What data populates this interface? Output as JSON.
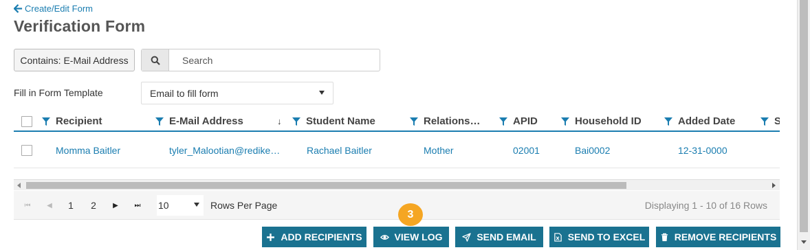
{
  "header": {
    "back_link": "Create/Edit Form",
    "title": "Verification Form"
  },
  "filter": {
    "contains_label": "Contains: E-Mail Address",
    "search_placeholder": "Search"
  },
  "template": {
    "label": "Fill in Form Template",
    "selected": "Email to fill form"
  },
  "table": {
    "columns": [
      {
        "label": "Recipient"
      },
      {
        "label": "E-Mail Address",
        "sort": "↓"
      },
      {
        "label": "Student Name"
      },
      {
        "label": "Relations…"
      },
      {
        "label": "APID"
      },
      {
        "label": "Household ID"
      },
      {
        "label": "Added Date"
      },
      {
        "label": "S"
      }
    ],
    "rows": [
      {
        "recipient": "Momma Baitler",
        "email": "tyler_Malootian@redike…",
        "student": "Rachael Baitler",
        "relationship": "Mother",
        "apid": "02001",
        "household": "Bai0002",
        "added_date": "12-31-0000"
      }
    ]
  },
  "pager": {
    "pages": [
      "1",
      "2"
    ],
    "rows_per_page": "10",
    "rows_label": "Rows Per Page",
    "displaying": "Displaying 1 - 10 of 16 Rows"
  },
  "badge": "3",
  "actions": {
    "add": "ADD RECIPIENTS",
    "view_log": "VIEW LOG",
    "send_email": "SEND EMAIL",
    "send_excel": "SEND TO EXCEL",
    "remove": "REMOVE RECIPIENTS"
  },
  "colors": {
    "accent": "#1a7db0",
    "button": "#1a7290",
    "badge": "#f5a623"
  }
}
